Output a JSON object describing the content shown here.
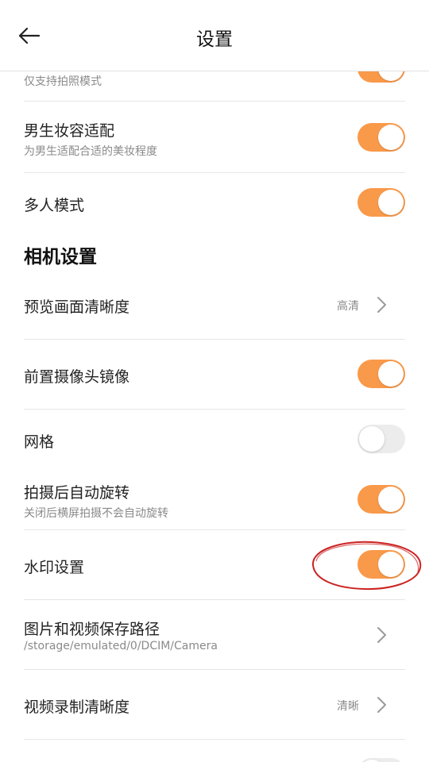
{
  "header": {
    "title": "设置",
    "back_icon": "arrow-left-icon"
  },
  "rows": {
    "photo_only": {
      "subtitle": "仅支持拍照模式",
      "toggle_on": true
    },
    "male_makeup": {
      "title": "男生妆容适配",
      "subtitle": "为男生适配合适的美妆程度",
      "toggle_on": true
    },
    "multi_person": {
      "title": "多人模式",
      "toggle_on": true
    }
  },
  "camera_section": {
    "title": "相机设置",
    "preview_quality": {
      "title": "预览画面清晰度",
      "value": "高清"
    },
    "front_mirror": {
      "title": "前置摄像头镜像",
      "toggle_on": true
    },
    "grid": {
      "title": "网格",
      "toggle_on": false
    },
    "auto_rotate": {
      "title": "拍摄后自动旋转",
      "subtitle": "关闭后横屏拍摄不会自动旋转",
      "toggle_on": true
    },
    "watermark": {
      "title": "水印设置",
      "toggle_on": true
    },
    "save_path": {
      "title": "图片和视频保存路径",
      "subtitle": "/storage/emulated/0/DCIM/Camera"
    },
    "video_quality": {
      "title": "视频录制清晰度",
      "value": "清晰"
    }
  },
  "colors": {
    "accent": "#f9994a",
    "toggle_off": "#ececec",
    "annotation": "#cc2222"
  }
}
